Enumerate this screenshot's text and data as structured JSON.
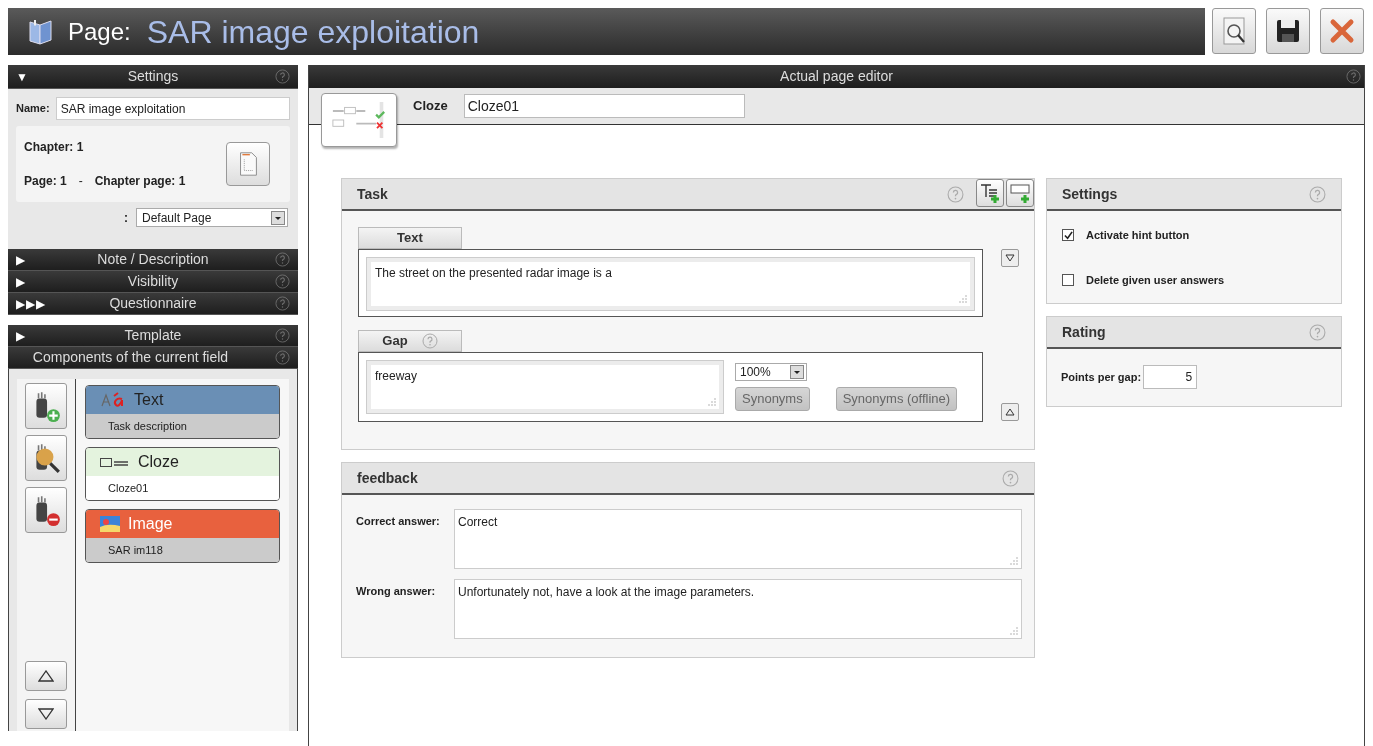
{
  "title_bar": {
    "prefix": "Page:",
    "title": "SAR image exploitation"
  },
  "left_panel": {
    "settings": {
      "marker": "▼",
      "title": "Settings",
      "expanded": true,
      "name_label": "Name:",
      "name_value": "SAR image exploitation",
      "chapter": "Chapter: 1",
      "page": "Page: 1",
      "separator": "-",
      "chapter_page": "Chapter page: 1",
      "layout_colon": ":",
      "layout_value": "Default Page"
    },
    "sections": [
      {
        "marker": "▶",
        "title": "Note / Description"
      },
      {
        "marker": "▶",
        "title": "Visibility"
      },
      {
        "marker": "▶▶▶",
        "title": "Questionnaire"
      }
    ],
    "template": {
      "marker": "▶",
      "title": "Template"
    },
    "components": {
      "title": "Components of the current field",
      "items": [
        {
          "kind": "text",
          "title": "Text",
          "subtitle": "Task description",
          "color": "#6a8fb5",
          "selected": false
        },
        {
          "kind": "cloze",
          "title": "Cloze",
          "subtitle": "Cloze01",
          "color": "#e4f3de",
          "selected": true
        },
        {
          "kind": "image",
          "title": "Image",
          "subtitle": "SAR im118",
          "color": "#e8613e",
          "selected": false
        }
      ]
    }
  },
  "editor": {
    "title": "Actual page editor",
    "type_label": "Cloze",
    "type_value": "Cloze01",
    "task": {
      "title": "Task",
      "text_tab": "Text",
      "text_value": "The street on the presented radar image is a",
      "gap_tab": "Gap",
      "gap_value": "freeway",
      "percent": "100%",
      "synonyms_buttons": [
        "Synonyms",
        "Synonyms (offline)"
      ]
    },
    "feedback": {
      "title": "feedback",
      "rows": [
        {
          "label": "Correct answer:",
          "value": "Correct"
        },
        {
          "label": "Wrong answer:",
          "value": "Unfortunately not, have a look at the image parameters."
        }
      ]
    },
    "settings": {
      "title": "Settings",
      "options": [
        {
          "label": "Activate hint button",
          "checked": true
        },
        {
          "label": "Delete given user answers",
          "checked": false
        }
      ]
    },
    "rating": {
      "title": "Rating",
      "label": "Points per gap:",
      "value": "5"
    }
  }
}
